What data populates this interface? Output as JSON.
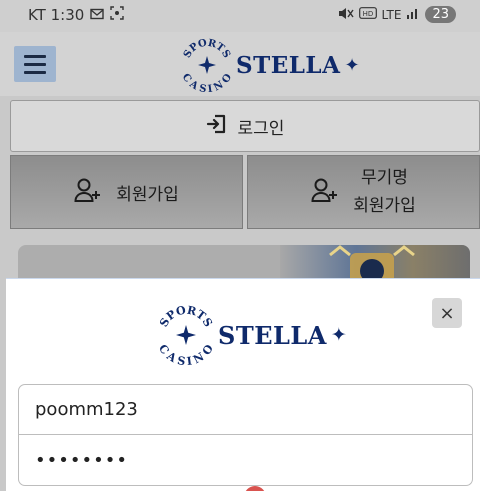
{
  "status_bar": {
    "time": "KT 1:30",
    "network": "LTE",
    "battery": "23"
  },
  "header": {
    "logo_text": "STELLA",
    "logo_badge_top": "SPORTS",
    "logo_badge_bottom": "CASINO"
  },
  "nav": {
    "login_label": "로그인",
    "register_label": "회원가입",
    "anon_register_line1": "무기명",
    "anon_register_line2": "회원가입"
  },
  "login_modal": {
    "logo_text": "STELLA",
    "logo_badge_top": "SPORTS",
    "logo_badge_bottom": "CASINO",
    "close_label": "×",
    "username_value": "poomm123",
    "password_value": "••••••••"
  },
  "colors": {
    "brand": "#0f2a6b",
    "menu_button": "#9eb4cf",
    "accent_red": "#d9534f"
  }
}
